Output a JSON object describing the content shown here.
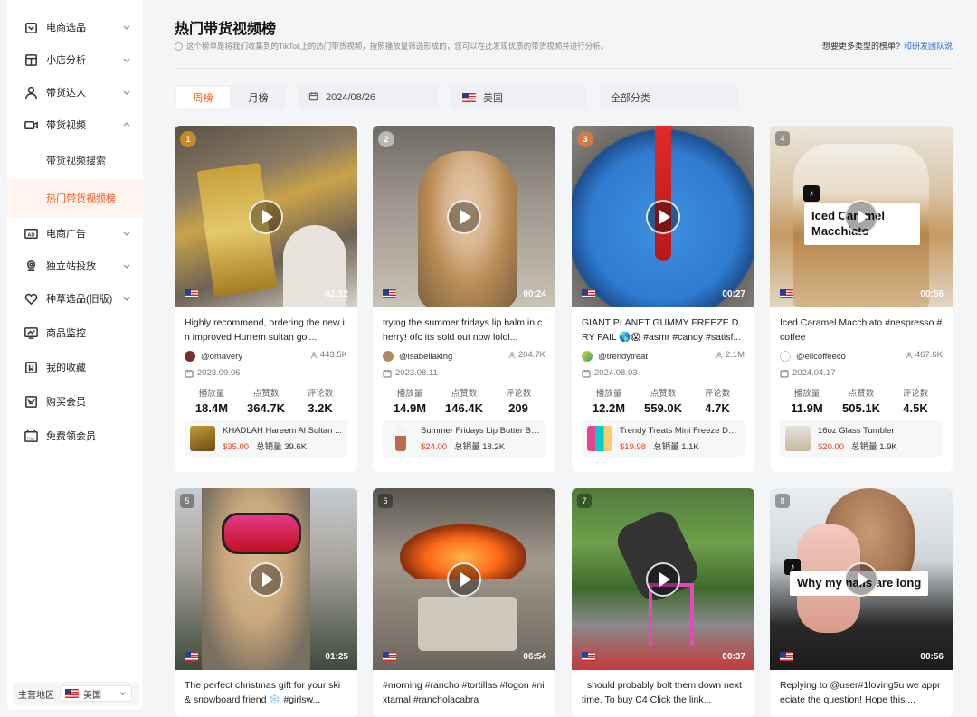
{
  "sidebar": {
    "items": [
      {
        "label": "电商选品",
        "icon": "shopping-bag-icon",
        "expanded": false
      },
      {
        "label": "小店分析",
        "icon": "store-icon",
        "expanded": false
      },
      {
        "label": "带货达人",
        "icon": "user-icon",
        "expanded": false
      },
      {
        "label": "带货视频",
        "icon": "video-camera-icon",
        "expanded": true
      },
      {
        "label": "电商广告",
        "icon": "ad-icon",
        "expanded": false
      },
      {
        "label": "独立站投放",
        "icon": "location-icon",
        "expanded": false
      },
      {
        "label": "种草选品(旧版)",
        "icon": "heart-icon",
        "expanded": false
      },
      {
        "label": "商品监控",
        "icon": "monitor-icon"
      },
      {
        "label": "我的收藏",
        "icon": "bookmark-icon"
      },
      {
        "label": "购买会员",
        "icon": "crown-icon"
      },
      {
        "label": "免费领会员",
        "icon": "free-icon"
      }
    ],
    "sub_items": [
      {
        "label": "带货视频搜索",
        "active": false
      },
      {
        "label": "热门带货视频榜",
        "active": true
      }
    ],
    "region_label": "主营地区",
    "region_value": "美国"
  },
  "header": {
    "title": "热门带货视频榜",
    "description": "这个榜单是将我们收集到的TikTok上的热门带货视频，按照播放量筛选形成的，您可以在此发现优质的带货视频并进行分析。",
    "more_prompt": "想要更多类型的榜单?",
    "more_link": "和研发团队说"
  },
  "filters": {
    "period_options": [
      "周榜",
      "月榜"
    ],
    "period_active": "周榜",
    "date": "2024/08/26",
    "country": "美国",
    "category": "全部分类"
  },
  "stat_labels": {
    "plays": "播放量",
    "likes": "点赞数",
    "comments": "评论数",
    "total_sales": "总销量"
  },
  "colors": {
    "accent": "#ff5a1f",
    "price": "#e5401d",
    "link": "#2f6bdc"
  },
  "videos": [
    {
      "rank": "1",
      "duration": "02:12",
      "title": "Highly recommend, ordering the new in improved Hurrem sultan gol...",
      "author": "@omavery",
      "followers": "443.5K",
      "date": "2023.09.06",
      "plays": "18.4M",
      "likes": "364.7K",
      "comments": "3.2K",
      "product_name": "KHADLAH Hareem Al Sultan ...",
      "price": "$35.00",
      "sales": "39.6K"
    },
    {
      "rank": "2",
      "duration": "00:24",
      "title": "trying the summer fridays lip balm in cherry! ofc its sold out now lolol...",
      "author": "@isabellaking",
      "followers": "204.7K",
      "date": "2023.08.11",
      "plays": "14.9M",
      "likes": "146.4K",
      "comments": "209",
      "product_name": "Summer Fridays Lip Butter Ba...",
      "price": "$24.00",
      "sales": "18.2K"
    },
    {
      "rank": "3",
      "duration": "00:27",
      "title": "GIANT PLANET GUMMY FREEZE DRY FAIL 🌎😱 #asmr #candy #satisf...",
      "author": "@trendytreat",
      "followers": "2.1M",
      "date": "2024.08.03",
      "plays": "12.2M",
      "likes": "559.0K",
      "comments": "4.7K",
      "product_name": "Trendy Treats Mini Freeze Dri...",
      "price": "$19.98",
      "sales": "1.1K"
    },
    {
      "rank": "4",
      "duration": "00:56",
      "title": "Iced Caramel Macchiato #nespresso #coffee",
      "author": "@elicoffeeco",
      "followers": "467.6K",
      "date": "2024.04.17",
      "plays": "11.9M",
      "likes": "505.1K",
      "comments": "4.5K",
      "product_name": "16oz Glass Tumbler",
      "price": "$20.00",
      "sales": "1.9K",
      "overlay": "Iced Caramel Macchiato"
    },
    {
      "rank": "5",
      "duration": "01:25",
      "title": "The perfect christmas gift for your ski & snowboard friend ❄️ #girlsw..."
    },
    {
      "rank": "6",
      "duration": "06:54",
      "title": "#morning #rancho #tortillas #fogon #nixtamal #rancholacabra"
    },
    {
      "rank": "7",
      "duration": "00:37",
      "title": "I should probably bolt them down next time. To buy C4 Click the link..."
    },
    {
      "rank": "8",
      "duration": "00:56",
      "title": "Replying to @user#1loving5u we appreciate the question! Hope this ...",
      "overlay": "Why my nails are long"
    }
  ]
}
